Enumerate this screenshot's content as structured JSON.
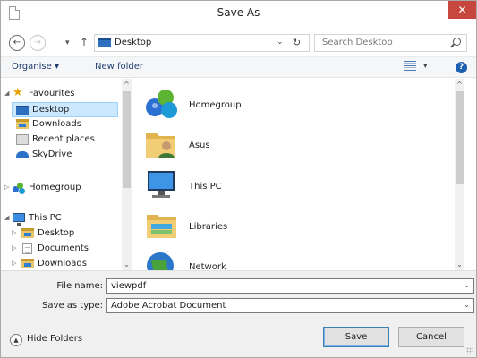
{
  "window": {
    "title": "Save As",
    "close_glyph": "✕"
  },
  "toolbar": {
    "back_glyph": "←",
    "forward_glyph": "→",
    "recent_glyph": "▾",
    "up_glyph": "↑",
    "address": "Desktop",
    "address_dropdown_glyph": "⌄",
    "refresh_glyph": "↻",
    "search_placeholder": "Search Desktop"
  },
  "commands": {
    "organise": "Organise ▾",
    "new_folder": "New folder",
    "view_dropdown": "▾",
    "help": "?"
  },
  "nav": {
    "favourites": {
      "label": "Favourites",
      "expanded": "◢"
    },
    "fav_items": [
      {
        "label": "Desktop",
        "selected": true
      },
      {
        "label": "Downloads"
      },
      {
        "label": "Recent places"
      },
      {
        "label": "SkyDrive"
      }
    ],
    "homegroup": {
      "label": "Homegroup",
      "collapsed": "▷"
    },
    "thispc": {
      "label": "This PC",
      "expanded": "◢"
    },
    "pc_items": [
      {
        "label": "Desktop",
        "collapsed": "▷"
      },
      {
        "label": "Documents",
        "collapsed": "▷"
      },
      {
        "label": "Downloads",
        "collapsed": "▷"
      }
    ]
  },
  "main_items": [
    "Homegroup",
    "Asus",
    "This PC",
    "Libraries",
    "Network"
  ],
  "scroll": {
    "up": "▲",
    "down": "▼",
    "up_alt": "^",
    "down_alt": "⌄"
  },
  "form": {
    "file_name_label": "File name:",
    "file_name_value": "viewpdf",
    "type_label": "Save as type:",
    "type_value": "Adobe Acrobat Document",
    "dropdown_glyph": "⌄"
  },
  "buttons": {
    "hide_folders": "Hide Folders",
    "hide_glyph": "▲",
    "save": "Save",
    "cancel": "Cancel"
  },
  "colors": {
    "selection": "#cce8ff",
    "close": "#c7463e",
    "link": "#1e3e70"
  }
}
